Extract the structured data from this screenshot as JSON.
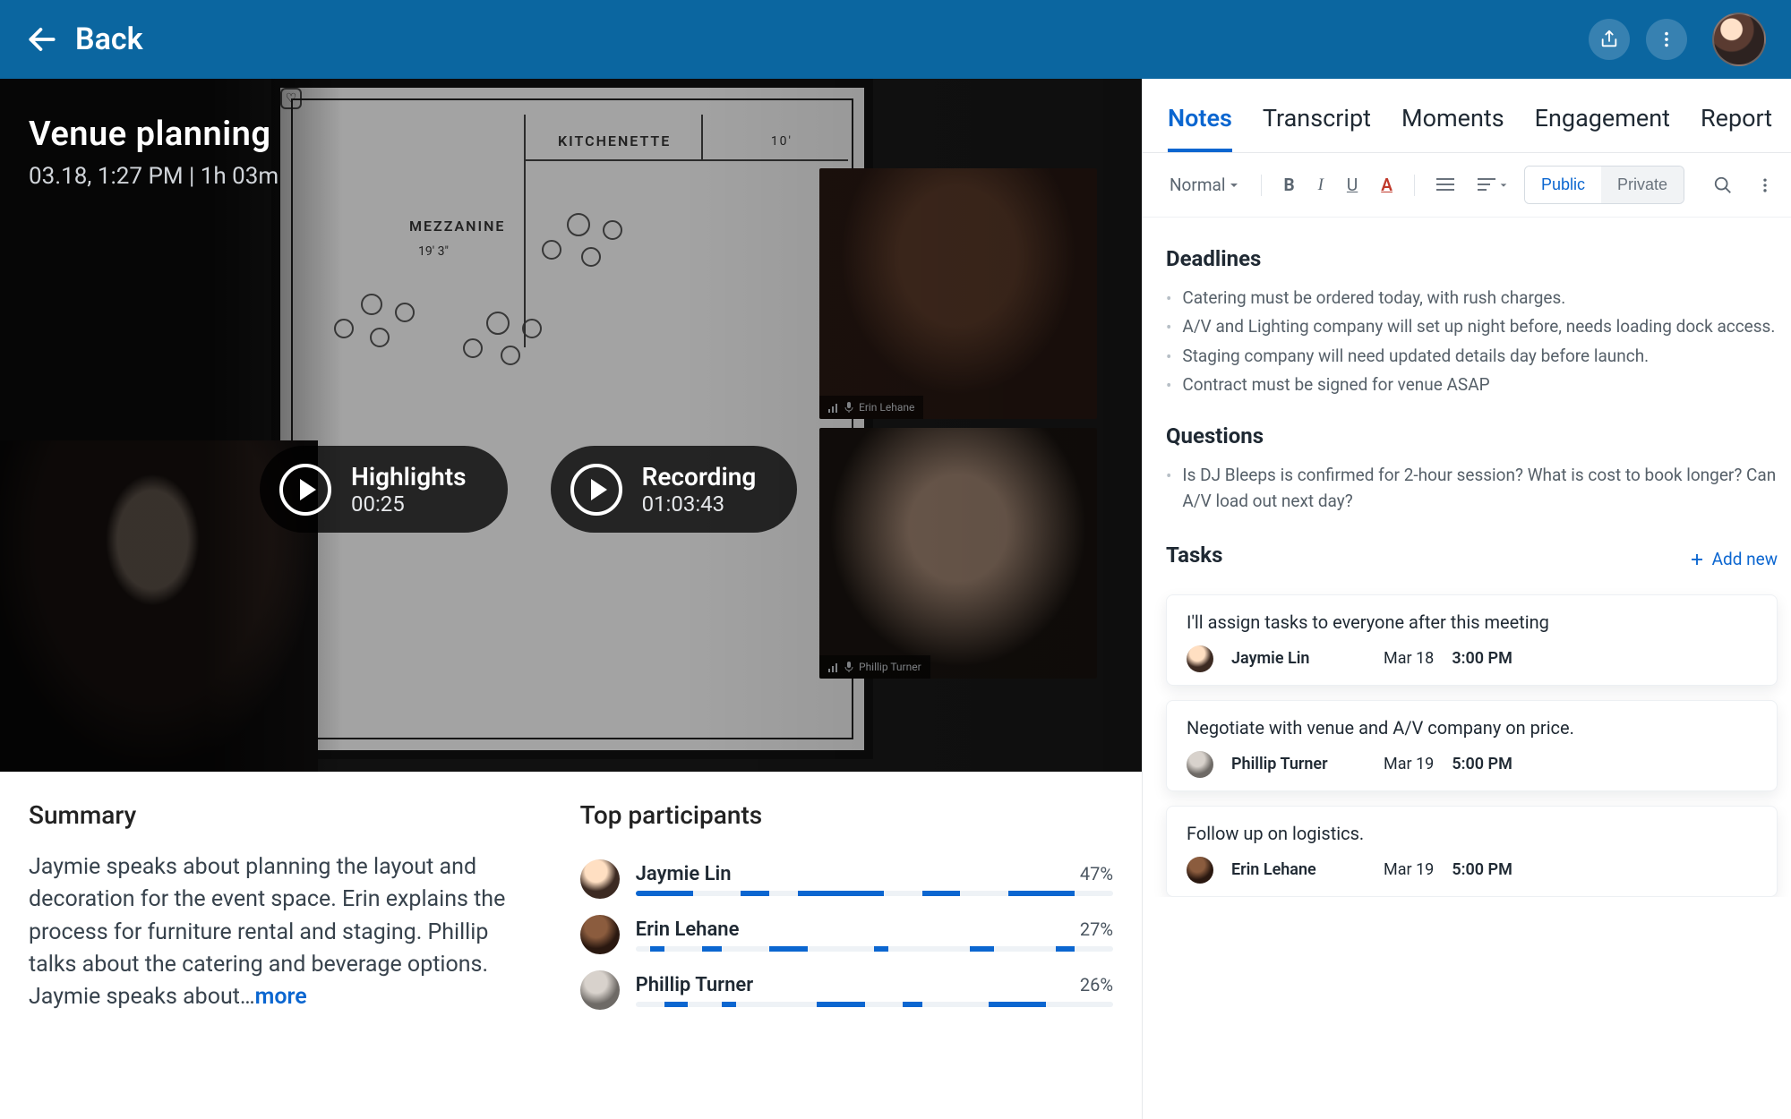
{
  "topbar": {
    "back_label": "Back"
  },
  "hero": {
    "title": "Venue planning",
    "subtitle": "03.18, 1:27 PM | 1h 03m",
    "highlights_label": "Highlights",
    "highlights_duration": "00:25",
    "recording_label": "Recording",
    "recording_duration": "01:03:43",
    "participant1_caption": "Erin Lehane",
    "participant2_caption": "Phillip Turner",
    "floorplan": {
      "mezz": "MEZZANINE",
      "kitch": "KITCHENETTE",
      "mezz_dim": "19' 3\"",
      "top_dim": "10'"
    }
  },
  "summary": {
    "heading": "Summary",
    "text": "Jaymie speaks about planning the layout and decoration for the event space. Erin explains the process for furniture rental and staging. Phillip talks about the catering and beverage options. Jaymie speaks about…",
    "more": "more"
  },
  "participants": {
    "heading": "Top participants",
    "rows": [
      {
        "name": "Jaymie Lin",
        "pct": "47%"
      },
      {
        "name": "Erin Lehane",
        "pct": "27%"
      },
      {
        "name": "Phillip Turner",
        "pct": "26%"
      }
    ]
  },
  "tabs": {
    "notes": "Notes",
    "transcript": "Transcript",
    "moments": "Moments",
    "engagement": "Engagement",
    "report": "Report"
  },
  "editor": {
    "format_label": "Normal",
    "public_label": "Public",
    "private_label": "Private"
  },
  "notes": {
    "deadlines_heading": "Deadlines",
    "deadlines": [
      "Catering must be ordered today, with rush charges.",
      "A/V and Lighting company will set up night before, needs loading dock access.",
      "Staging company will need updated details day before launch.",
      "Contract must be signed for venue ASAP"
    ],
    "questions_heading": "Questions",
    "questions": [
      "Is DJ Bleeps is confirmed for 2-hour session? What is cost to book longer? Can A/V load out next day?"
    ],
    "tasks_heading": "Tasks",
    "add_new_label": "Add new",
    "tasks": [
      {
        "title": "I'll assign tasks to everyone after this meeting",
        "assignee": "Jaymie Lin",
        "date": "Mar 18",
        "time": "3:00 PM"
      },
      {
        "title": "Negotiate with venue and A/V company on price.",
        "assignee": "Phillip Turner",
        "date": "Mar 19",
        "time": "5:00 PM"
      },
      {
        "title": "Follow up on logistics.",
        "assignee": "Erin Lehane",
        "date": "Mar 19",
        "time": "5:00 PM"
      }
    ]
  }
}
